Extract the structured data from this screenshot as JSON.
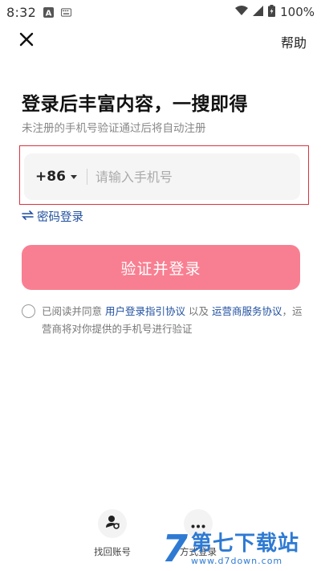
{
  "status_bar": {
    "time": "8:32",
    "battery_text": "100%",
    "icons": [
      "a-icon",
      "keyboard-icon",
      "wifi-icon",
      "signal-icon",
      "battery-icon"
    ]
  },
  "header": {
    "close_icon": "close-icon",
    "help_label": "帮助"
  },
  "title": "登录后丰富内容，一搜即得",
  "subtitle": "未注册的手机号验证通过后将自动注册",
  "phone": {
    "country_code": "+86",
    "placeholder": "请输入手机号",
    "value": ""
  },
  "password_login_label": "密码登录",
  "verify_button_label": "验证并登录",
  "agreement": {
    "text_prefix": "已阅读并同意 ",
    "link1": "用户登录指引协议",
    "text_middle": " 以及 ",
    "link2": "运营商服务协议",
    "text_suffix": "，运营商将对你提供的手机号进行验证"
  },
  "alternatives": [
    {
      "label": "找回账号",
      "icon": "user-recover-icon"
    },
    {
      "label": "方式登录",
      "icon": "more-icon"
    }
  ],
  "watermark": {
    "number": "7",
    "title": "第七下载站",
    "url": "www.d7down.com"
  },
  "colors": {
    "accent_link": "#1f4f9f",
    "button_bg": "#f87f91",
    "highlight": "#d9343f"
  }
}
